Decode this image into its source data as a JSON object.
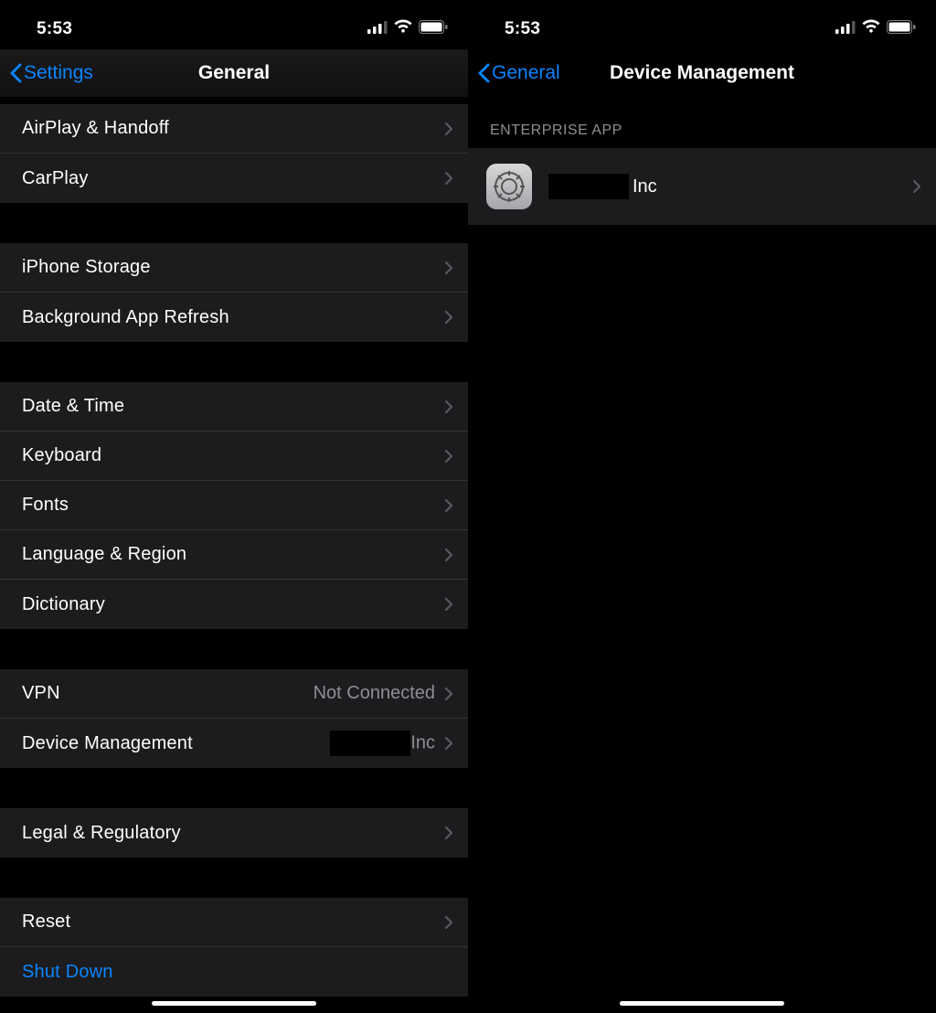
{
  "status": {
    "time": "5:53"
  },
  "left": {
    "back_label": "Settings",
    "title": "General",
    "groups": [
      {
        "rows": [
          {
            "label": "AirPlay & Handoff"
          },
          {
            "label": "CarPlay"
          }
        ]
      },
      {
        "rows": [
          {
            "label": "iPhone Storage"
          },
          {
            "label": "Background App Refresh"
          }
        ]
      },
      {
        "rows": [
          {
            "label": "Date & Time"
          },
          {
            "label": "Keyboard"
          },
          {
            "label": "Fonts"
          },
          {
            "label": "Language & Region"
          },
          {
            "label": "Dictionary"
          }
        ]
      },
      {
        "rows": [
          {
            "label": "VPN",
            "detail": "Not Connected"
          },
          {
            "label": "Device Management",
            "detail_suffix": "Inc",
            "redacted": true
          }
        ]
      },
      {
        "rows": [
          {
            "label": "Legal & Regulatory"
          }
        ]
      },
      {
        "rows": [
          {
            "label": "Reset"
          },
          {
            "label": "Shut Down",
            "link": true,
            "no_chev": true
          }
        ]
      }
    ]
  },
  "right": {
    "back_label": "General",
    "title": "Device Management",
    "section_header": "Enterprise App",
    "enterprise_suffix": "Inc"
  }
}
